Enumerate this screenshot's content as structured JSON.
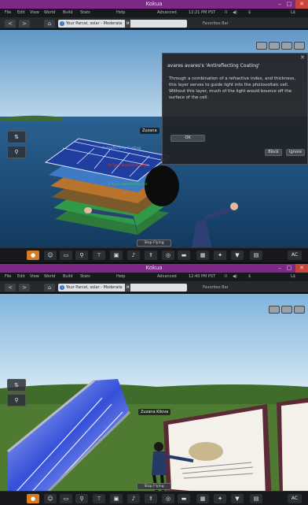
{
  "windows": [
    {
      "title": "Kokua",
      "window_controls": {
        "minimize": "–",
        "maximize": "□",
        "close": "✕"
      },
      "menu": {
        "items": [
          "File",
          "Edit",
          "View",
          "World",
          "Build",
          "Stats",
          "Help",
          "Advanced"
        ],
        "right_items": [
          "12:21 PM PST",
          "II",
          "◀)",
          "$",
          "L$"
        ]
      },
      "nav": {
        "back": "<",
        "forward": ">",
        "home": "⌂",
        "location": "Your Parcel, solar - Moderate",
        "maturity_badge": "M",
        "favorites_label": "Favorites Bar"
      },
      "dialog": {
        "title": "avares avares's 'Antireflecting Coating'",
        "body": "Through a combination of a refractive index, and thickness, this layer serves to guide light into the photovoltaic cell. Without this layer, much of the light would bounce off the surface of the cell.",
        "ok_label": "OK",
        "block_label": "Block",
        "ignore_label": "Ignore",
        "close_label": "✕"
      },
      "scene": {
        "avatar_name": "Zuzana",
        "object_labels": [
          "Antireflecting Coating",
          "N-Type Semiconductor",
          "P-Type Semiconductor"
        ],
        "stop_flying_label": "Stop Flying"
      },
      "toolbar": {
        "ac_label": "AC"
      }
    },
    {
      "title": "Kokua",
      "window_controls": {
        "minimize": "–",
        "maximize": "□",
        "close": "✕"
      },
      "menu": {
        "items": [
          "File",
          "Edit",
          "View",
          "World",
          "Build",
          "Stats",
          "Help",
          "Advanced"
        ],
        "right_items": [
          "12:40 PM PST",
          "II",
          "◀)",
          "$",
          "L$"
        ]
      },
      "nav": {
        "back": "<",
        "forward": ">",
        "home": "⌂",
        "location": "Your Parcel, solar - Moderate",
        "maturity_badge": "M",
        "favorites_label": "Favorites Bar"
      },
      "scene": {
        "avatar_name": "Zuzana Kilova",
        "stop_flying_label": "Stop Flying"
      },
      "toolbar": {
        "ac_label": "AC"
      }
    }
  ],
  "colors": {
    "titlebar": "#7c2a86",
    "toolbar_active": "#d67b1f",
    "sky_top": "#7fb4dd",
    "sea": "#1d4a73",
    "grass": "#4f7a31"
  },
  "icons": {
    "sidebar": [
      "walk-icon",
      "location-pin-icon"
    ],
    "toolbar": [
      "speak-icon",
      "people-icon",
      "snapshot-icon",
      "search-icon",
      "build-icon",
      "inventory-icon",
      "gestures-icon",
      "move-icon",
      "view-icon",
      "mini-map-icon",
      "world-map-icon",
      "places-icon",
      "appearance-icon",
      "media-icon"
    ]
  }
}
